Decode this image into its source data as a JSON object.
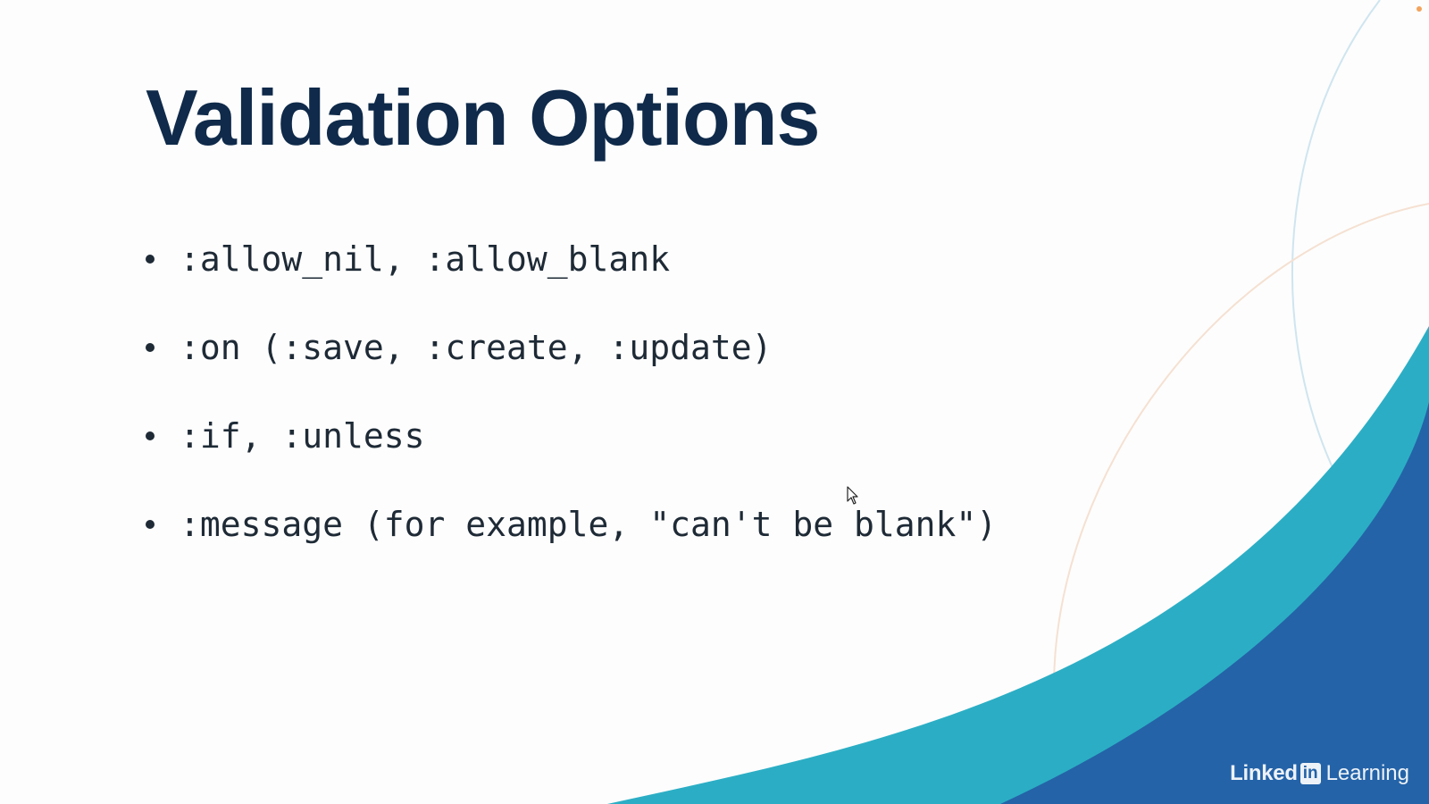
{
  "slide": {
    "title": "Validation Options",
    "bullets": [
      ":allow_nil, :allow_blank",
      ":on (:save, :create, :update)",
      ":if, :unless",
      ":message (for example, \"can't be blank\")"
    ]
  },
  "branding": {
    "linked": "Linked",
    "in_badge": "in",
    "learning": "Learning"
  },
  "colors": {
    "title": "#0f2a4a",
    "text": "#1e2a36",
    "wave_teal": "#2baec5",
    "wave_blue": "#2463a8",
    "background": "#fdfdfd"
  },
  "icons": {
    "cursor": "mouse-pointer-icon",
    "bullet": "bullet-dot-icon"
  }
}
